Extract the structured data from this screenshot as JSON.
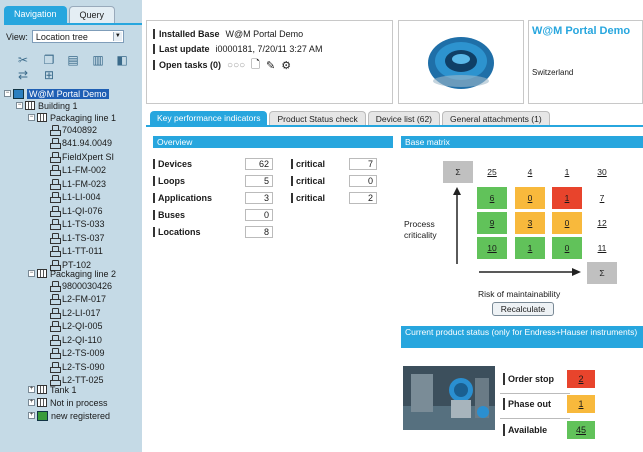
{
  "left_panel": {
    "tabs": [
      {
        "label": "Navigation",
        "active": true
      },
      {
        "label": "Query",
        "active": false
      }
    ],
    "view_label": "View:",
    "view_value": "Location tree",
    "tree": {
      "root": "W@M Portal Demo",
      "building": "Building 1",
      "line1": "Packaging line 1",
      "line1_items": [
        "7040892",
        "841.94.0049",
        "FieldXpert SI",
        "L1-FM-002",
        "L1-FM-023",
        "L1-LI-004",
        "L1-QI-076",
        "L1-TS-033",
        "L1-TS-037",
        "L1-TT-011",
        "PT-102"
      ],
      "line2": "Packaging line 2",
      "line2_items": [
        "9800030426",
        "L2-FM-017",
        "L2-LI-017",
        "L2-QI-005",
        "L2-QI-110",
        "L2-TS-009",
        "L2-TS-090",
        "L2-TT-025"
      ],
      "tank": "Tank 1",
      "not_in_process": "Not in process",
      "new_registered": "new registered"
    }
  },
  "header": {
    "installed_base_label": "Installed Base",
    "installed_base_value": "W@M Portal Demo",
    "last_update_label": "Last update",
    "last_update_value": "i0000181, 7/20/11 3:27 AM",
    "open_tasks_label": "Open tasks (0)",
    "company_name": "W@M Portal Demo",
    "country": "Switzerland"
  },
  "main_tabs": [
    {
      "label": "Key performance indicators",
      "active": true
    },
    {
      "label": "Product Status check",
      "active": false
    },
    {
      "label": "Device list (62)",
      "active": false
    },
    {
      "label": "General attachments (1)",
      "active": false
    }
  ],
  "overview": {
    "title": "Overview",
    "rows": [
      {
        "label": "Devices",
        "value": "62",
        "critical_label": "critical",
        "critical_value": "7"
      },
      {
        "label": "Loops",
        "value": "5",
        "critical_label": "critical",
        "critical_value": "0"
      },
      {
        "label": "Applications",
        "value": "3",
        "critical_label": "critical",
        "critical_value": "2"
      },
      {
        "label": "Buses",
        "value": "0"
      },
      {
        "label": "Locations",
        "value": "8"
      }
    ]
  },
  "matrix": {
    "title": "Base matrix",
    "y_label": "Process criticality",
    "x_label": "Risk of maintainability",
    "recalculate": "Recalculate",
    "sigma": "Σ",
    "col_totals": [
      "25",
      "4",
      "1",
      "30"
    ],
    "rows": [
      {
        "values": [
          "6",
          "0",
          "1"
        ],
        "colors": [
          "#61c25a",
          "#f8b93c",
          "#e8442c"
        ],
        "total": "7"
      },
      {
        "values": [
          "9",
          "3",
          "0"
        ],
        "colors": [
          "#61c25a",
          "#f8b93c",
          "#f8b93c"
        ],
        "total": "12"
      },
      {
        "values": [
          "10",
          "1",
          "0"
        ],
        "colors": [
          "#61c25a",
          "#61c25a",
          "#61c25a"
        ],
        "total": "11"
      }
    ]
  },
  "product_status": {
    "title": "Current product status (only for Endress+Hauser instruments)",
    "rows": [
      {
        "label": "Order stop",
        "value": "2",
        "color": "#e8442c"
      },
      {
        "label": "Phase out",
        "value": "1",
        "color": "#f8b93c"
      },
      {
        "label": "Available",
        "value": "45",
        "color": "#61c25a"
      }
    ]
  }
}
